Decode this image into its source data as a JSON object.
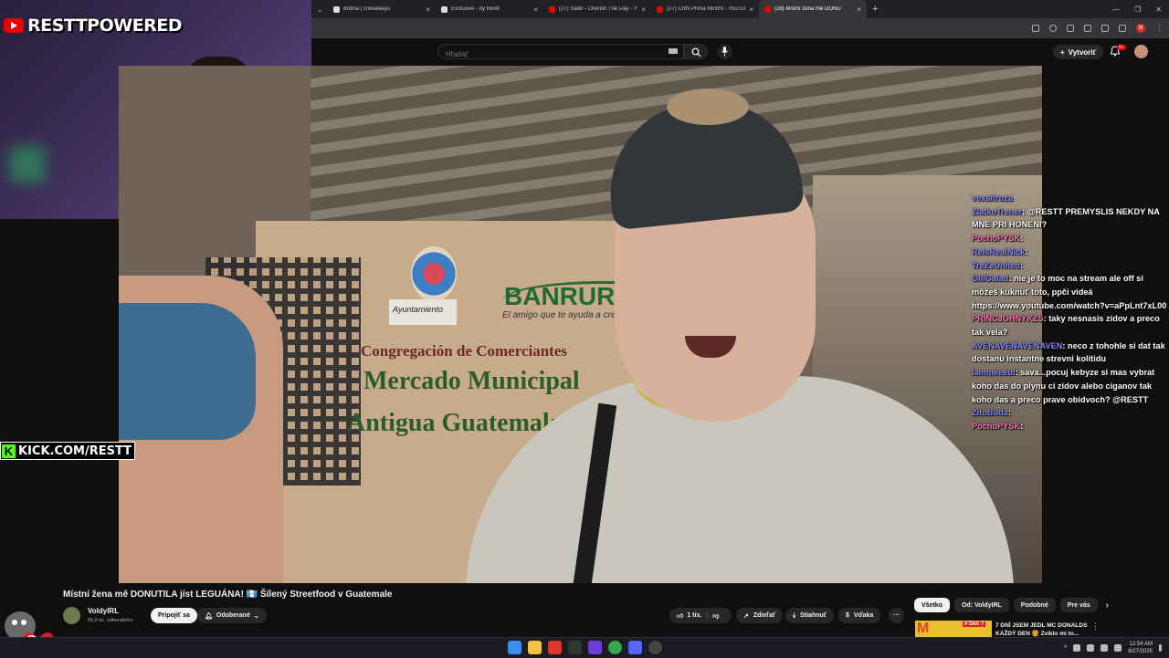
{
  "overlay": {
    "brand": "RESTTPOWERED",
    "kick": "KICK.COM/RESTT"
  },
  "browser": {
    "tabs": [
      {
        "label": "Botiña | Giveaways",
        "icon": "star-icon"
      },
      {
        "label": "Exclusive - by Restt",
        "icon": "doc-icon"
      },
      {
        "label": "(27) Sade - Cherish The Day - Y",
        "icon": "youtube-icon"
      },
      {
        "label": "(27) CNN Prima NEWS - YouTube",
        "icon": "youtube-icon"
      },
      {
        "label": "(28) Místní žena mě DONU",
        "icon": "youtube-icon",
        "active": true
      }
    ],
    "new_tab": "+"
  },
  "youtube": {
    "search_placeholder": "Hľadať",
    "create_label": "Vytvoriť",
    "notifications": "9+",
    "chat": [
      {
        "user": "vexsitroza",
        "text": "",
        "color": "blue"
      },
      {
        "user": "ZlatkoTrener",
        "text": ": @RESTT PREMYSLIS NEKDY NA MNE PRI HONENI?",
        "color": "blue"
      },
      {
        "user": "PochoPYSK",
        "text": ":",
        "color": "pink"
      },
      {
        "user": "ReIsRealNick",
        "text": ":",
        "color": "blue"
      },
      {
        "user": "TreZeUnited",
        "text": ":",
        "color": "blue"
      },
      {
        "user": "GillGalad",
        "text": ": nie je to moc na stream ale off si môžeš kuknuť toto, ppči videá https://www.youtube.com/watch?v=aPpLnt7xL00",
        "color": "blue"
      },
      {
        "user": "PRINCJOHNYKZS",
        "text": ": taky nesnasis zidov a preco tak vela?",
        "color": "pink"
      },
      {
        "user": "AVENAVENAVENAVEN",
        "text": ": neco z tohohle si dat tak dostanu instantne strevni kolitidu",
        "color": "blue"
      },
      {
        "user": "Iammeeeul",
        "text": ": sava...pocuj kebyze si mas vybrat koho das do plynu ci zidov alebo ciganov tak koho das a preco prave obidvoch? @RESTT",
        "color": "blue"
      },
      {
        "user": "ZitoBuda",
        "text": ":",
        "color": "blue"
      },
      {
        "user": "PochoPYSK",
        "text": ":",
        "color": "pink"
      }
    ],
    "video": {
      "sign_crest_label": "Ayuntamiento",
      "sign_bank": "BANRURAL",
      "sign_bank_tagline": "El amigo que te ayuda a crecer",
      "wall_line1": "Congregación de Comerciantes",
      "wall_line2": "Mercado Municipal",
      "wall_line3": "Antigua Guatemala"
    },
    "title": "Místní žena mě DONUTILA jíst LEGUÁNA! 🇬🇹 Šílený Streetfood v Guatemale",
    "channel": {
      "name": "VoldyIRL",
      "subscribers": "65,9 tis. odberateľov",
      "join_label": "Pripojiť sa",
      "subscribed_label": "Odoberané"
    },
    "actions": {
      "likes": "1 tis.",
      "share": "Zdieľať",
      "download": "Stiahnuť",
      "thanks": "Vďaka",
      "more": "···"
    },
    "chips": [
      "Všetko",
      "Od: VoldyIRL",
      "Podobné",
      "Pre vás"
    ],
    "recommendation": {
      "thumb_badge": "# Den 7",
      "title_line1": "7 DNÍ JSEM JEDL MC DONALDS",
      "title_line2": "KAŽDÝ DEN 🍔 Zvíklo mi to..."
    }
  },
  "taskbar": {
    "time": "12:54 AM",
    "date": "8/27/2025"
  },
  "colors": {
    "youtube_red": "#ff0000",
    "kick_green": "#53fc18",
    "chat_name_blue": "#8a8aff",
    "background": "#0f0f0f"
  }
}
